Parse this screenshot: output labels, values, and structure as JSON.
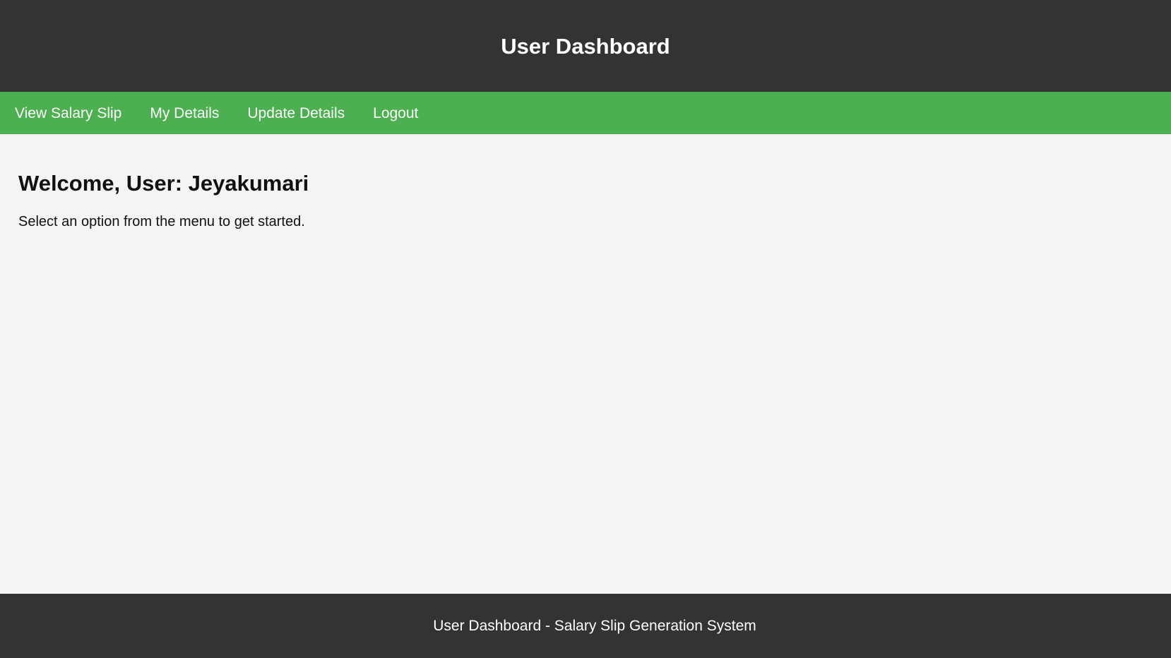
{
  "header": {
    "title": "User Dashboard"
  },
  "nav": {
    "items": [
      {
        "label": "View Salary Slip"
      },
      {
        "label": "My Details"
      },
      {
        "label": "Update Details"
      },
      {
        "label": "Logout"
      }
    ]
  },
  "main": {
    "welcome": "Welcome, User: Jeyakumari",
    "instruction": "Select an option from the menu to get started."
  },
  "footer": {
    "text": "User Dashboard - Salary Slip Generation System"
  },
  "colors": {
    "header_bg": "#333333",
    "nav_bg": "#4caf50",
    "page_bg": "#f4f4f4",
    "footer_bg": "#333333",
    "text_light": "#ffffff",
    "text_dark": "#111111"
  }
}
